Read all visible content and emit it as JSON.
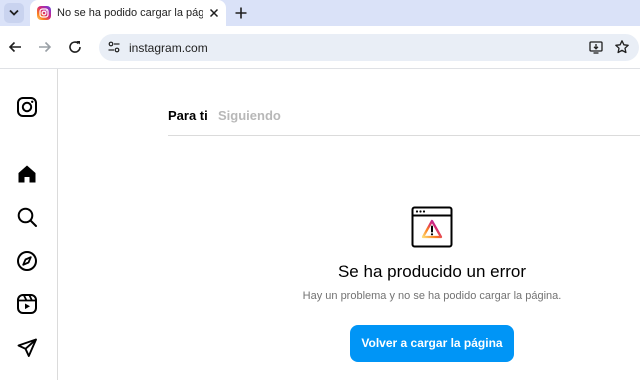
{
  "browser": {
    "tab": {
      "title": "No se ha podido cargar la página"
    },
    "new_tab_label": "+",
    "address_bar": {
      "url": "instagram.com"
    }
  },
  "sidebar": {
    "icons": [
      "instagram-logo-icon",
      "home-icon",
      "search-icon",
      "explore-icon",
      "reels-icon",
      "messages-icon"
    ]
  },
  "feed": {
    "tabs": [
      {
        "label": "Para ti",
        "active": true
      },
      {
        "label": "Siguiendo",
        "active": false
      }
    ]
  },
  "error": {
    "title": "Se ha producido un error",
    "description": "Hay un problema y no se ha podido cargar la página.",
    "button_label": "Volver a cargar la página"
  },
  "colors": {
    "primary_button": "#0095f6",
    "tabstrip": "#dae2f8",
    "omnibox": "#e9eef6"
  }
}
